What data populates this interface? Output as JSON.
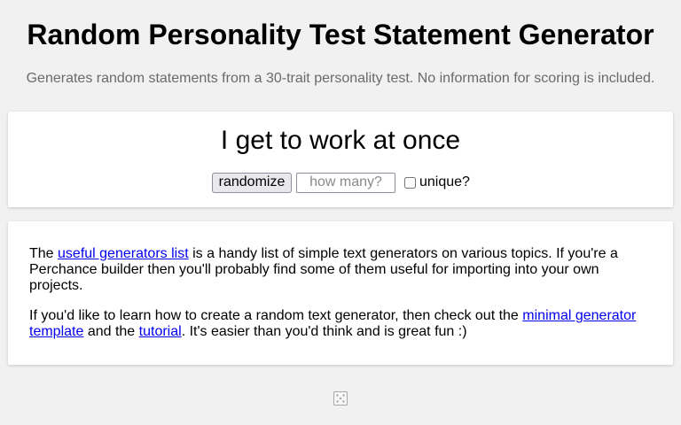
{
  "header": {
    "title": "Random Personality Test Statement Generator",
    "subtitle": "Generates random statements from a 30-trait personality test. No information for scoring is included."
  },
  "output": {
    "statement": "I get to work at once",
    "randomize_label": "randomize",
    "count_placeholder": "how many?",
    "unique_label": "unique?",
    "unique_checked": false
  },
  "info": {
    "p1_pre": "The ",
    "p1_link": "useful generators list",
    "p1_post": " is a handy list of simple text generators on various topics. If you're a Perchance builder then you'll probably find some of them useful for importing into your own projects.",
    "p2_pre": "If you'd like to learn how to create a random text generator, then check out the ",
    "p2_link1": "minimal generator template",
    "p2_mid": " and the ",
    "p2_link2": "tutorial",
    "p2_post": ". It's easier than you'd think and is great fun :)"
  },
  "footer": {
    "icon": "dice-icon"
  }
}
